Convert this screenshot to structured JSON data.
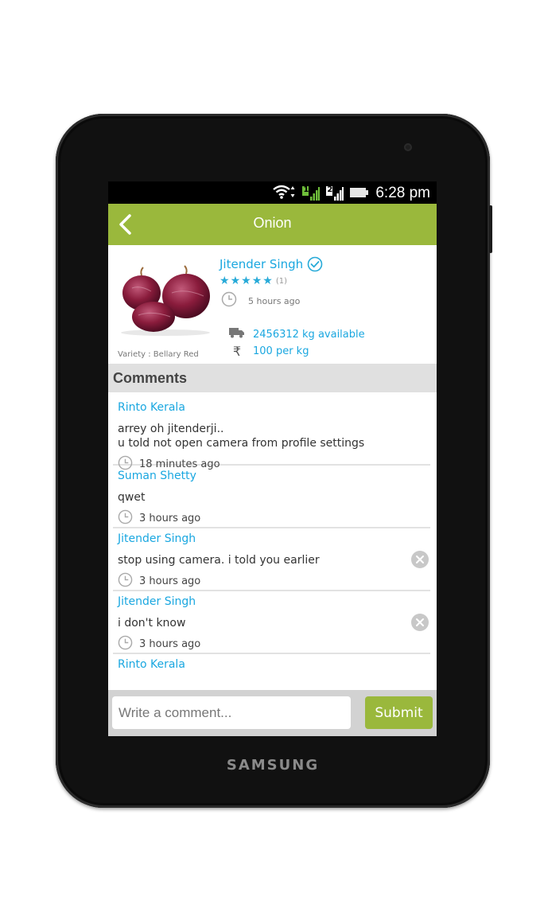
{
  "device": {
    "brand": "SAMSUNG"
  },
  "status_bar": {
    "time": "6:28 pm",
    "sim1": "1",
    "sim2": "2"
  },
  "app_bar": {
    "title": "Onion"
  },
  "product": {
    "seller_name": "Jitender Singh",
    "rating": 5,
    "rating_count": "(1)",
    "posted_time": "5 hours ago",
    "variety": "Variety : Bellary Red",
    "availability": "2456312 kg available",
    "price": "100 per kg"
  },
  "comments": {
    "header": "Comments",
    "items": [
      {
        "author": "Rinto Kerala",
        "lines": [
          "arrey oh jitenderji..",
          "u told not open camera from profile settings"
        ],
        "time": "18 minutes ago"
      },
      {
        "author": "Suman Shetty",
        "lines": [
          "qwet"
        ],
        "time": "3 hours ago"
      },
      {
        "author": "Jitender Singh",
        "lines": [
          "stop using camera.  i told you earlier"
        ],
        "time": "3 hours ago"
      },
      {
        "author": "Jitender Singh",
        "lines": [
          "i don't know"
        ],
        "time": "3 hours ago"
      },
      {
        "author": "Rinto Kerala"
      }
    ]
  },
  "composer": {
    "placeholder": "Write a comment...",
    "submit_label": "Submit"
  },
  "colors": {
    "accent_green": "#9ab83c",
    "link_blue": "#1aa7e0",
    "star_blue": "#27aad8"
  }
}
